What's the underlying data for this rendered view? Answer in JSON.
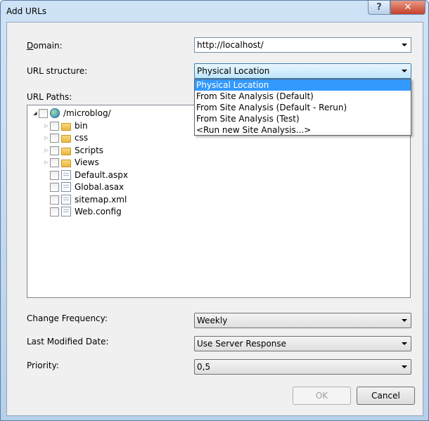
{
  "window": {
    "title": "Add URLs",
    "help_label": "?",
    "close_label": "✕"
  },
  "domain": {
    "label_accel": "D",
    "label_rest": "omain:",
    "value": "http://localhost/"
  },
  "url_structure": {
    "label": "URL structure:",
    "value": "Physical Location",
    "options": [
      "Physical Location",
      "From Site Analysis (Default)",
      "From Site Analysis (Default - Rerun)",
      "From Site Analysis (Test)",
      "<Run new Site Analysis...>"
    ]
  },
  "url_paths": {
    "label": "URL Paths:",
    "root": "/microblog/",
    "items": [
      {
        "name": "bin",
        "icon": "folder-icon"
      },
      {
        "name": "css",
        "icon": "folder-icon"
      },
      {
        "name": "Scripts",
        "icon": "folder-icon"
      },
      {
        "name": "Views",
        "icon": "folder-icon"
      },
      {
        "name": "Default.aspx",
        "icon": "aspx-file-icon"
      },
      {
        "name": "Global.asax",
        "icon": "asax-file-icon"
      },
      {
        "name": "sitemap.xml",
        "icon": "xml-file-icon"
      },
      {
        "name": "Web.config",
        "icon": "config-file-icon"
      }
    ]
  },
  "change_frequency": {
    "label": "Change Frequency:",
    "value": "Weekly"
  },
  "last_modified": {
    "label": "Last Modified Date:",
    "value": "Use Server Response"
  },
  "priority": {
    "label": "Priority:",
    "value": "0,5"
  },
  "buttons": {
    "ok": "OK",
    "cancel": "Cancel"
  }
}
